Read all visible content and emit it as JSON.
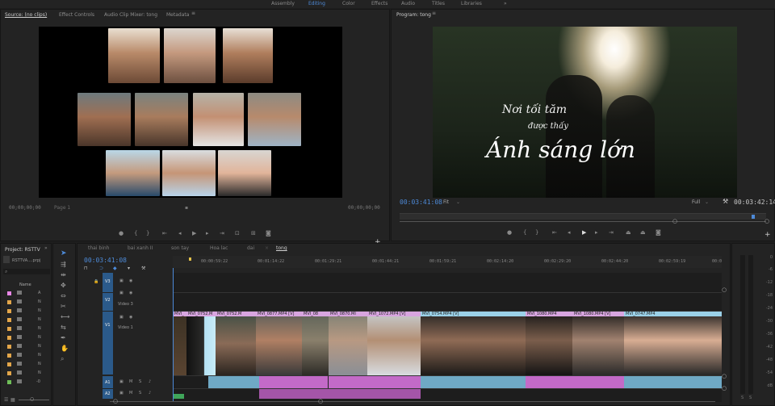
{
  "workspace": {
    "items": [
      "Assembly",
      "Editing",
      "Color",
      "Effects",
      "Audio",
      "Titles",
      "Libraries",
      "»"
    ],
    "active_index": 1
  },
  "source_panel": {
    "tabs": [
      "Source: (no clips)",
      "Effect Controls",
      "Audio Clip Mixer: tong",
      "Metadata"
    ],
    "timecode_left": "00;00;00;00",
    "page_label": "Page 1",
    "timecode_right": "00;00;00;00"
  },
  "program_panel": {
    "tab": "Program: tong",
    "title_line1": "Nơi tối tăm",
    "title_line2": "được thấy",
    "title_line3": "Ánh sáng lớn",
    "timecode_current": "00:03:41:08",
    "fit": "Fit",
    "quality": "Full",
    "timecode_duration": "00:03:42:14"
  },
  "project_panel": {
    "tab": "Project: RSTTV",
    "file": "RSTTVA....prpj",
    "name_header": "Name",
    "rows": [
      "A",
      "N",
      "N",
      "N",
      "N",
      "N",
      "N",
      "N",
      "N",
      "N",
      "-0"
    ]
  },
  "timeline": {
    "sequence_tabs": [
      "thai binh",
      "bai xanh II",
      "son tay",
      "Hoa lac",
      "dai",
      "tong"
    ],
    "active_tab": 5,
    "timecode": "00:03:41:08",
    "ruler": [
      "00:00:59:22",
      "00:01:14:22",
      "00:01:29:21",
      "00:01:44:21",
      "00:01:59:21",
      "00:02:14:20",
      "00:02:29:20",
      "00:02:44:20",
      "00:02:59:19",
      "00:0"
    ],
    "tracks": {
      "v3": "V3",
      "v2": "V2",
      "v2_name": "Video 3",
      "v1": "V1",
      "v1_name": "Video 1",
      "a1": "A1",
      "a2": "A2"
    },
    "clips": [
      "MVI_",
      "MVI_0752.M",
      "MVI_0877.MP4 [V]",
      "MVI_08",
      "MVI_0870.MI",
      "MVI_1072.MP4 [V]",
      "MVI_0754.MP4 [V]",
      "MVI_1080.MP4",
      "MVI_1080.MP4 [V]",
      "MVI_0747.MP4"
    ]
  },
  "audio_meter": {
    "labels": [
      "0",
      "-6",
      "-12",
      "-18",
      "-24",
      "-30",
      "-36",
      "-42",
      "-48",
      "-54",
      "dB"
    ],
    "bottom": [
      "S",
      "S"
    ]
  }
}
